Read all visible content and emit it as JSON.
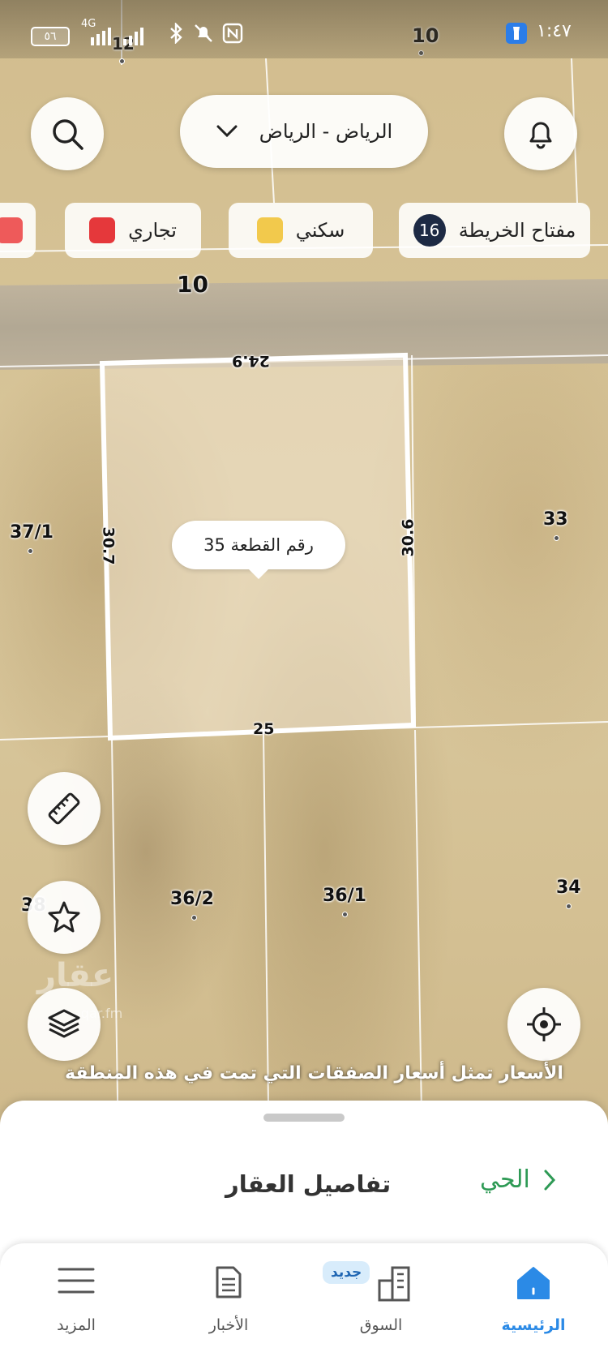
{
  "status_bar": {
    "time": "١:٤٧",
    "network": "4G",
    "battery": "٥٦"
  },
  "header": {
    "city": "الرياض - الرياض"
  },
  "legend": {
    "key_label": "مفتاح الخريطة",
    "key_count": "16",
    "chips": [
      {
        "label": "سكني",
        "color": "#f2c94c"
      },
      {
        "label": "تجاري",
        "color": "#e5383b"
      }
    ]
  },
  "map": {
    "street_labels": [
      "10",
      "10"
    ],
    "plot_numbers": [
      "12",
      "37/1",
      "33",
      "36/2",
      "36/1",
      "34",
      "38"
    ],
    "selected_plot": {
      "tooltip": "رقم القطعة 35",
      "dimensions": {
        "top": "24.9",
        "left": "30.7",
        "right": "30.6",
        "bottom": "25"
      }
    }
  },
  "price_note": "الأسعار تمثل أسعار الصفقات التي تمت في هذه المنطقة",
  "watermark": {
    "logo": "عقار",
    "site": "aqar.fm"
  },
  "sheet": {
    "title": "تفاصيل العقار",
    "district_link": "الحي"
  },
  "nav": {
    "home": "الرئيسية",
    "market": "السوق",
    "market_badge": "جديد",
    "news": "الأخبار",
    "more": "المزيد"
  },
  "colors": {
    "accent_green": "#2e9a55",
    "home_blue": "#2b8ae6",
    "badge_navy": "#1d2a44"
  }
}
